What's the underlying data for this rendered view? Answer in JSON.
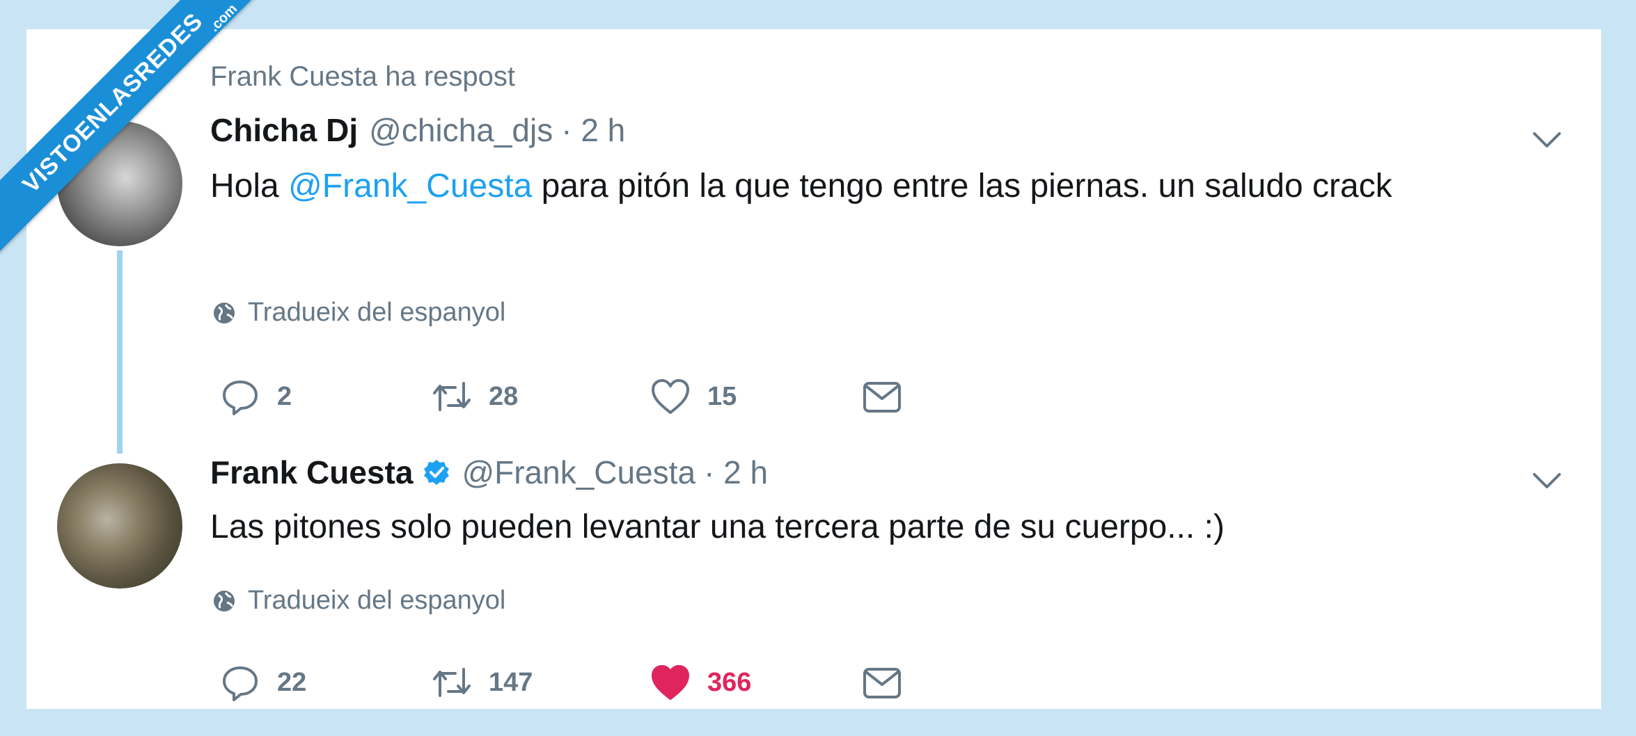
{
  "watermark": {
    "main": "VISTOENLASREDES",
    "sub": ".com"
  },
  "context_line": "Frank Cuesta ha respost",
  "tweets": [
    {
      "name": "Chicha Dj",
      "handle": "@chicha_djs",
      "time": "· 2 h",
      "verified": false,
      "text_before": "Hola ",
      "mention": "@Frank_Cuesta",
      "text_after": " para pitón la que tengo entre las piernas. un saludo crack",
      "translate": "Tradueix del espanyol",
      "replies": "2",
      "retweets": "28",
      "likes": "15",
      "liked": false
    },
    {
      "name": "Frank Cuesta",
      "handle": "@Frank_Cuesta",
      "time": "· 2 h",
      "verified": true,
      "text": "Las pitones solo pueden levantar una tercera parte de su cuerpo... :)",
      "translate": "Tradueix del espanyol",
      "replies": "22",
      "retweets": "147",
      "likes": "366",
      "liked": true
    }
  ],
  "colors": {
    "background": "#c8e4f5",
    "link": "#1da1f2",
    "liked": "#e0245e",
    "muted": "#657786",
    "banner": "#1a8fd8"
  },
  "icons": [
    "reply-icon",
    "retweet-icon",
    "like-icon",
    "direct-message-icon",
    "globe-icon",
    "chevron-down-icon",
    "verified-badge-icon"
  ]
}
